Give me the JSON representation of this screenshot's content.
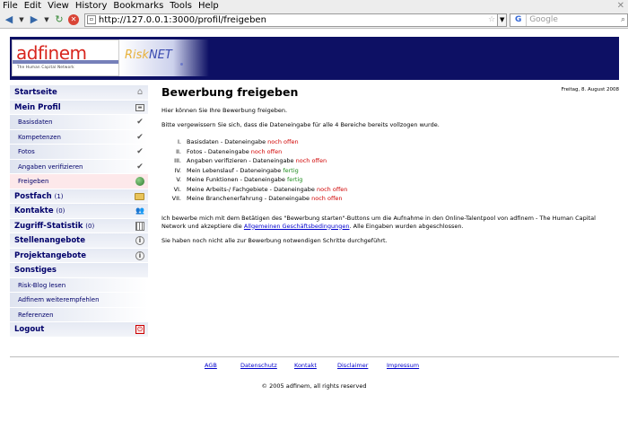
{
  "browser": {
    "menu": [
      "File",
      "Edit",
      "View",
      "History",
      "Bookmarks",
      "Tools",
      "Help"
    ],
    "url": "http://127.0.0.1:3000/profil/freigeben",
    "search_placeholder": "Google"
  },
  "header": {
    "logo_text": "adfinem",
    "logo_tagline": "The Human Capital Network",
    "risknet_part1": "Risk",
    "risknet_part2": "NET"
  },
  "sidebar": {
    "items": [
      {
        "label": "Startseite",
        "icon": "home-icon"
      },
      {
        "label": "Mein Profil",
        "icon": "id-card-icon"
      },
      {
        "label": "Basisdaten",
        "icon": "check-icon"
      },
      {
        "label": "Kompetenzen",
        "icon": "check-icon"
      },
      {
        "label": "Fotos",
        "icon": "check-icon"
      },
      {
        "label": "Angaben verifizieren",
        "icon": "check-icon"
      },
      {
        "label": "Freigeben",
        "icon": "globe-icon"
      },
      {
        "label": "Postfach",
        "count": "(1)",
        "icon": "folder-icon"
      },
      {
        "label": "Kontakte",
        "count": "(0)",
        "icon": "people-icon"
      },
      {
        "label": "Zugriff-Statistik",
        "count": "(0)",
        "icon": "statistics-icon"
      },
      {
        "label": "Stellenangebote",
        "icon": "info-icon"
      },
      {
        "label": "Projektangebote",
        "icon": "info-icon"
      },
      {
        "label": "Sonstiges"
      },
      {
        "label": "Risk-Blog lesen"
      },
      {
        "label": "Adfinem weiterempfehlen"
      },
      {
        "label": "Referenzen"
      },
      {
        "label": "Logout",
        "icon": "logout-icon"
      }
    ]
  },
  "main": {
    "title": "Bewerbung freigeben",
    "date": "Freitag, 8. August 2008",
    "intro": "Hier können Sie Ihre Bewerbung freigeben.",
    "hint": "Bitte vergewissern Sie sich, dass die Dateneingabe für alle 4 Bereiche bereits vollzogen wurde.",
    "steps": [
      {
        "num": "I.",
        "label": "Basisdaten - Dateneingabe",
        "status": "noch offen",
        "state": "open"
      },
      {
        "num": "II.",
        "label": "Fotos - Dateneingabe",
        "status": "noch offen",
        "state": "open"
      },
      {
        "num": "III.",
        "label": "Angaben verifizieren - Dateneingabe",
        "status": "noch offen",
        "state": "open"
      },
      {
        "num": "IV.",
        "label": "Mein Lebenslauf - Dateneingabe",
        "status": "fertig",
        "state": "done"
      },
      {
        "num": "V.",
        "label": "Meine Funktionen - Dateneingabe",
        "status": "fertig",
        "state": "done"
      },
      {
        "num": "VI.",
        "label": "Meine Arbeits-/ Fachgebiete - Dateneingabe",
        "status": "noch offen",
        "state": "open"
      },
      {
        "num": "VII.",
        "label": "Meine Branchenerfahrung - Dateneingabe",
        "status": "noch offen",
        "state": "open"
      }
    ],
    "terms_prefix": "Ich bewerbe mich mit dem Betätigen des \"Bewerbung starten\"-Buttons um die Aufnahme in den Online-Talentpool von adfinem - The Human Capital Network und akzeptiere die",
    "terms_link": "Allgemeinen Geschäftsbedingungen",
    "terms_suffix": ". Alle Eingaben wurden abgeschlossen.",
    "status_text": "Sie haben noch nicht alle zur Bewerbung notwendigen Schritte durchgeführt."
  },
  "footer": {
    "links": [
      "AGB",
      "Datenschutz",
      "Kontakt",
      "Disclaimer",
      "Impressum"
    ],
    "copyright": "© 2005 adfinem, all rights reserved"
  },
  "colors": {
    "banner": "#0d1064",
    "nav_text": "#00006a",
    "status_open": "#d00000",
    "status_done": "#1c8a1c",
    "link": "#0000cc"
  }
}
